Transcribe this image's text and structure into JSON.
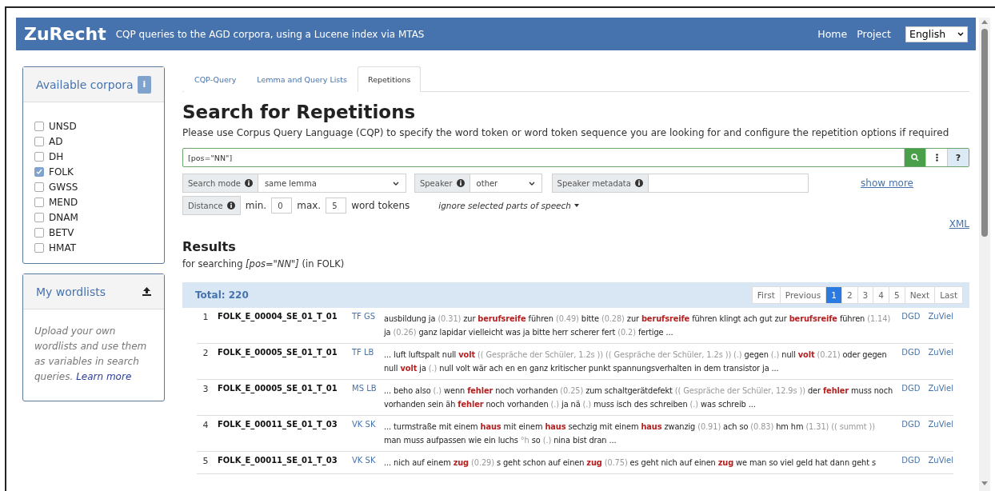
{
  "navbar": {
    "brand": "ZuRecht",
    "tagline": "CQP queries to the AGD corpora, using a Lucene index via MTAS",
    "links": [
      "Home",
      "Project"
    ],
    "language": "English"
  },
  "sidebar": {
    "corpora_title": "Available corpora",
    "info": "i",
    "corpora": [
      {
        "label": "UNSD",
        "checked": false
      },
      {
        "label": "AD",
        "checked": false
      },
      {
        "label": "DH",
        "checked": false
      },
      {
        "label": "FOLK",
        "checked": true
      },
      {
        "label": "GWSS",
        "checked": false
      },
      {
        "label": "MEND",
        "checked": false
      },
      {
        "label": "DNAM",
        "checked": false
      },
      {
        "label": "BETV",
        "checked": false
      },
      {
        "label": "HMAT",
        "checked": false
      }
    ],
    "wordlists_title": "My wordlists",
    "wordlists_text": "Upload your own wordlists and use them as variables in search queries.",
    "learn_more": "Learn more"
  },
  "tabs": [
    {
      "label": "CQP-Query",
      "selected": false
    },
    {
      "label": "Lemma and Query Lists",
      "selected": false
    },
    {
      "label": "Repetitions",
      "selected": true
    }
  ],
  "title": "Search for Repetitions",
  "description": "Please use Corpus Query Language (CQP) to specify the word token or word token sequence you are looking for and configure the repetition options if required",
  "query": {
    "value": "[pos=\"NN\"]",
    "help": "?"
  },
  "options": {
    "search_mode_label": "Search mode",
    "search_mode": "same lemma",
    "speaker_label": "Speaker",
    "speaker": "other",
    "speaker_metadata_label": "Speaker metadata",
    "show_more": "show more",
    "distance_label": "Distance",
    "min_label": "min.",
    "min": "0",
    "max_label": "max.",
    "max": "5",
    "unit": "word tokens",
    "ignore": "ignore selected parts of speech"
  },
  "xml": "XML",
  "results": {
    "title": "Results",
    "subtitle": "for searching *[pos=\"NN\"]* (in FOLK)",
    "total": "Total: 220",
    "pagination": [
      {
        "label": "First",
        "selected": false
      },
      {
        "label": "Previous",
        "selected": false
      },
      {
        "label": "1",
        "selected": true
      },
      {
        "label": "2",
        "selected": false
      },
      {
        "label": "3",
        "selected": false
      },
      {
        "label": "4",
        "selected": false
      },
      {
        "label": "5",
        "selected": false
      },
      {
        "label": "Next",
        "selected": false
      },
      {
        "label": "Last",
        "selected": false
      }
    ],
    "rows": [
      {
        "number": "1",
        "transcript": "FOLK_E_00004_SE_01_T_01",
        "speakers": "TF GS",
        "dgd": "DGD",
        "zuviel": "ZuViel",
        "segments": [
          {
            "kind": "word",
            "text": "ausbildung ja "
          },
          {
            "kind": "pause",
            "text": "(0.31)"
          },
          {
            "kind": "word",
            "text": " zur "
          },
          {
            "kind": "hit",
            "text": "berufsreife"
          },
          {
            "kind": "word",
            "text": " führen "
          },
          {
            "kind": "pause",
            "text": "(0.49)"
          },
          {
            "kind": "word",
            "text": " bitte "
          },
          {
            "kind": "pause",
            "text": "(0.28)"
          },
          {
            "kind": "word",
            "text": " zur "
          },
          {
            "kind": "hit",
            "text": "berufsreife"
          },
          {
            "kind": "word",
            "text": " führen klingt ach gut zur "
          },
          {
            "kind": "hit",
            "text": "berufsreife"
          },
          {
            "kind": "word",
            "text": " führen "
          },
          {
            "kind": "pause",
            "text": "(1.14)"
          },
          {
            "kind": "word",
            "text": " ja "
          },
          {
            "kind": "pause",
            "text": "(0.26)"
          },
          {
            "kind": "word",
            "text": " ganz lapidar vielleicht was ja bitte herr scherer fert "
          },
          {
            "kind": "pause",
            "text": "(0.2)"
          },
          {
            "kind": "word",
            "text": " fertige ..."
          }
        ]
      },
      {
        "number": "2",
        "transcript": "FOLK_E_00005_SE_01_T_01",
        "speakers": "TF LB",
        "dgd": "DGD",
        "zuviel": "ZuViel",
        "segments": [
          {
            "kind": "word",
            "text": "... luft luftspalt null "
          },
          {
            "kind": "hit",
            "text": "volt"
          },
          {
            "kind": "pause",
            "text": " (( Gespräche der Schüler, 1.2s ))"
          },
          {
            "kind": "pause",
            "text": " (( Gespräche der Schüler, 1.2s ))"
          },
          {
            "kind": "pause",
            "text": " (.)"
          },
          {
            "kind": "word",
            "text": " gegen "
          },
          {
            "kind": "pause",
            "text": "(.)"
          },
          {
            "kind": "word",
            "text": " null "
          },
          {
            "kind": "hit",
            "text": "volt"
          },
          {
            "kind": "pause",
            "text": " (0.21)"
          },
          {
            "kind": "word",
            "text": " oder gegen null "
          },
          {
            "kind": "hit",
            "text": "volt"
          },
          {
            "kind": "word",
            "text": " ja "
          },
          {
            "kind": "pause",
            "text": "(.)"
          },
          {
            "kind": "word",
            "text": " null volt wär ach en en ganz kritischer punkt spannungsverhalten in dem transistor ja ..."
          }
        ]
      },
      {
        "number": "3",
        "transcript": "FOLK_E_00005_SE_01_T_01",
        "speakers": "MS LB",
        "dgd": "DGD",
        "zuviel": "ZuViel",
        "segments": [
          {
            "kind": "word",
            "text": "... beho also "
          },
          {
            "kind": "pause",
            "text": "(.)"
          },
          {
            "kind": "word",
            "text": " wenn "
          },
          {
            "kind": "hit",
            "text": "fehler"
          },
          {
            "kind": "word",
            "text": " noch vorhanden "
          },
          {
            "kind": "pause",
            "text": "(0.25)"
          },
          {
            "kind": "word",
            "text": " zum schaltgerätdefekt "
          },
          {
            "kind": "pause",
            "text": "(( Gespräche der Schüler, 12.9s ))"
          },
          {
            "kind": "word",
            "text": " der "
          },
          {
            "kind": "hit",
            "text": "fehler"
          },
          {
            "kind": "word",
            "text": " muss noch vorhanden sein äh "
          },
          {
            "kind": "hit",
            "text": "fehler"
          },
          {
            "kind": "word",
            "text": " noch vorhanden "
          },
          {
            "kind": "pause",
            "text": "(.)"
          },
          {
            "kind": "word",
            "text": " ja nä "
          },
          {
            "kind": "pause",
            "text": "(.)"
          },
          {
            "kind": "word",
            "text": " muss isch des schreiben "
          },
          {
            "kind": "pause",
            "text": "(.)"
          },
          {
            "kind": "word",
            "text": " was schreib ..."
          }
        ]
      },
      {
        "number": "4",
        "transcript": "FOLK_E_00011_SE_01_T_03",
        "speakers": "VK SK",
        "dgd": "DGD",
        "zuviel": "ZuViel",
        "segments": [
          {
            "kind": "word",
            "text": "... turmstraße mit einem "
          },
          {
            "kind": "hit",
            "text": "haus"
          },
          {
            "kind": "word",
            "text": " mit einem "
          },
          {
            "kind": "hit",
            "text": "haus"
          },
          {
            "kind": "word",
            "text": " sechzig mit einem "
          },
          {
            "kind": "hit",
            "text": "haus"
          },
          {
            "kind": "word",
            "text": " zwanzig "
          },
          {
            "kind": "pause",
            "text": "(0.91)"
          },
          {
            "kind": "word",
            "text": " ach so "
          },
          {
            "kind": "pause",
            "text": "(0.83)"
          },
          {
            "kind": "word",
            "text": " hm hm "
          },
          {
            "kind": "pause",
            "text": "(1.31)"
          },
          {
            "kind": "pause",
            "text": " (( summt ))"
          },
          {
            "kind": "word",
            "text": " man muss aufpassen wie ein luchs "
          },
          {
            "kind": "pause",
            "text": "°h"
          },
          {
            "kind": "word",
            "text": " so "
          },
          {
            "kind": "pause",
            "text": "(.)"
          },
          {
            "kind": "word",
            "text": " nina bist dran ..."
          }
        ]
      },
      {
        "number": "5",
        "transcript": "FOLK_E_00011_SE_01_T_03",
        "speakers": "VK SK",
        "dgd": "DGD",
        "zuviel": "ZuViel",
        "segments": [
          {
            "kind": "word",
            "text": "... nich auf einem "
          },
          {
            "kind": "hit",
            "text": "zug"
          },
          {
            "kind": "pause",
            "text": " (0.29)"
          },
          {
            "kind": "word",
            "text": " s geht schon auf einen "
          },
          {
            "kind": "hit",
            "text": "zug"
          },
          {
            "kind": "pause",
            "text": " (0.75)"
          },
          {
            "kind": "word",
            "text": " es geht nich auf einen "
          },
          {
            "kind": "hit",
            "text": "zug"
          },
          {
            "kind": "word",
            "text": " we man so viel geld hat dann geht s"
          }
        ]
      }
    ]
  }
}
